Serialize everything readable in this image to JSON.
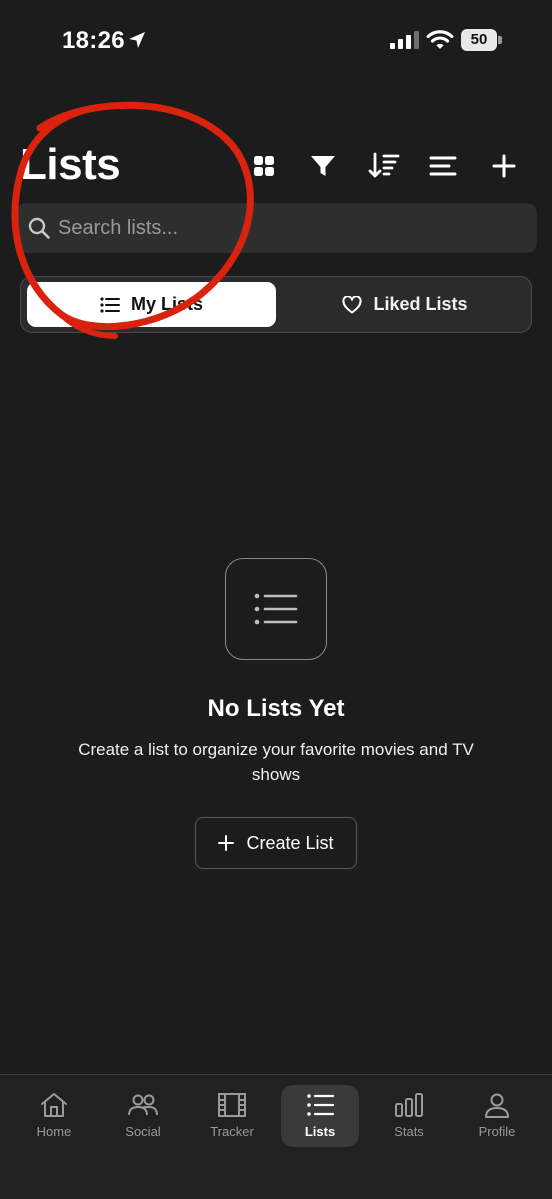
{
  "status_bar": {
    "time": "18:26",
    "battery": "50"
  },
  "header": {
    "title": "Lists"
  },
  "toolbar": {
    "icons": [
      "grid-view-icon",
      "filter-icon",
      "sort-icon",
      "list-view-icon",
      "plus-icon"
    ]
  },
  "search": {
    "placeholder": "Search lists...",
    "value": ""
  },
  "segmented": {
    "my_lists": "My Lists",
    "liked_lists": "Liked Lists",
    "selected": "My Lists"
  },
  "empty_state": {
    "title": "No Lists Yet",
    "description": "Create a list to organize your favorite movies and TV shows",
    "button": "Create List"
  },
  "nav": {
    "items": [
      {
        "label": "Home",
        "icon": "home-icon"
      },
      {
        "label": "Social",
        "icon": "people-icon"
      },
      {
        "label": "Tracker",
        "icon": "film-icon"
      },
      {
        "label": "Lists",
        "icon": "list-icon"
      },
      {
        "label": "Stats",
        "icon": "bar-chart-icon"
      },
      {
        "label": "Profile",
        "icon": "person-icon"
      }
    ],
    "active": "Lists"
  },
  "colors": {
    "background": "#1c1c1c",
    "surface": "#2e2e2e",
    "annotation": "#d9230f",
    "active_segment": "#ffffff"
  }
}
